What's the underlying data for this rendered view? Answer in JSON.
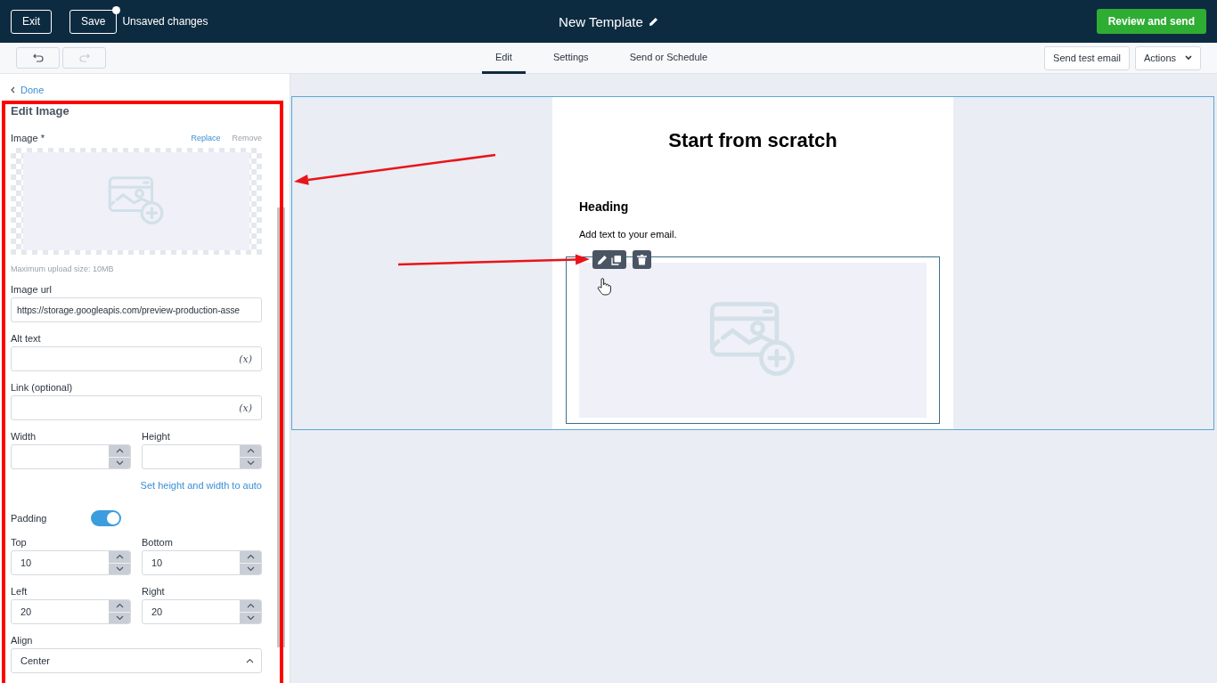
{
  "header": {
    "exit": "Exit",
    "save": "Save",
    "unsaved": true,
    "status": "Unsaved changes",
    "title": "New Template",
    "primary": "Review and send"
  },
  "toolbar": {
    "undo_disabled": false,
    "redo_disabled": true,
    "tabs": [
      {
        "label": "Edit",
        "selected": true
      },
      {
        "label": "Settings",
        "selected": false
      },
      {
        "label": "Send or Schedule",
        "selected": false
      }
    ],
    "send_test": "Send test email",
    "actions": "Actions"
  },
  "panel": {
    "back": "Done",
    "title": "Edit Image",
    "image_label": "Image *",
    "replace": "Replace",
    "remove": "Remove",
    "hint": "Maximum upload size: 10MB",
    "items": [
      {
        "kind": "text",
        "label": "Image url",
        "value": "https://storage.googleapis.com/preview-production-asse"
      },
      {
        "kind": "var",
        "label": "Alt text",
        "button": "(x)"
      },
      {
        "kind": "var",
        "label": "Link (optional)",
        "button": "(x)"
      },
      {
        "kind": "pair",
        "fields": [
          {
            "label": "Width"
          },
          {
            "label": "Height"
          }
        ]
      },
      {
        "kind": "link",
        "label": "Set height and width to auto"
      },
      {
        "kind": "toggle",
        "label": "Padding",
        "on": true
      },
      {
        "kind": "pair",
        "fields": [
          {
            "label": "Top",
            "value": "10"
          },
          {
            "label": "Bottom",
            "value": "10"
          }
        ]
      },
      {
        "kind": "pair",
        "fields": [
          {
            "label": "Left",
            "value": "20"
          },
          {
            "label": "Right",
            "value": "20"
          }
        ]
      },
      {
        "kind": "select",
        "label": "Align",
        "value": "Center"
      }
    ]
  },
  "email": {
    "title": "Start from scratch",
    "heading": "Heading",
    "text": "Add text to your email.",
    "image_selected": true
  }
}
